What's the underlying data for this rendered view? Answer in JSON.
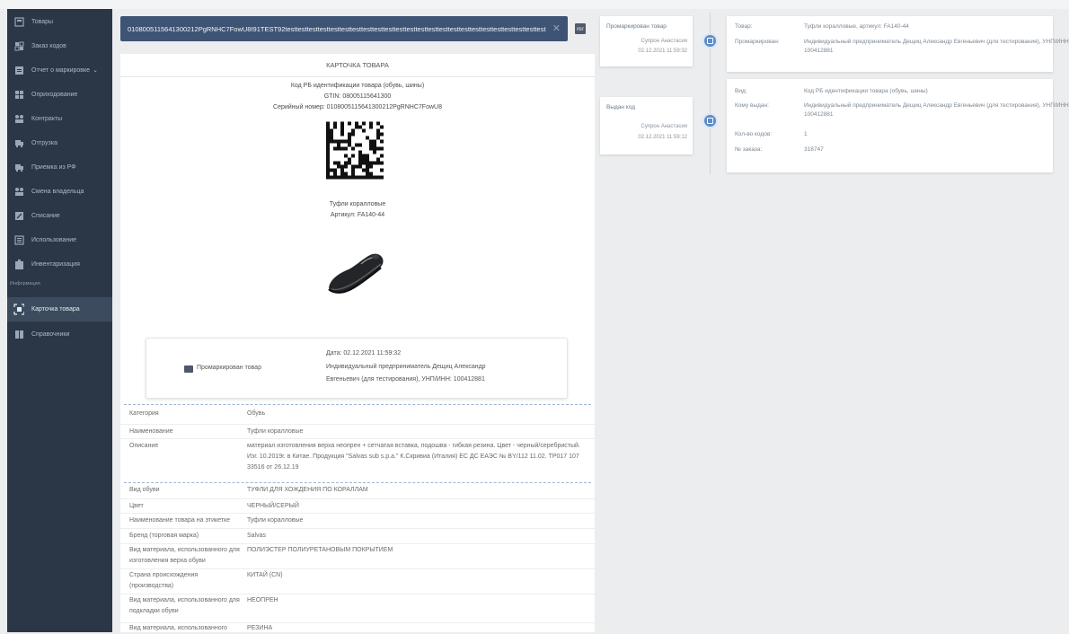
{
  "sidebar": {
    "items": [
      {
        "label": "Товары",
        "icon": "product-icon"
      },
      {
        "label": "Заказ кодов",
        "icon": "order-codes-icon"
      },
      {
        "label": "Отчет о маркировке",
        "icon": "report-icon",
        "chevron": "⌄"
      },
      {
        "label": "Оприходование",
        "icon": "receipt-icon"
      },
      {
        "label": "Контракты",
        "icon": "contracts-icon"
      },
      {
        "label": "Отгрузка",
        "icon": "shipment-icon"
      },
      {
        "label": "Приемка из РФ",
        "icon": "acceptance-icon"
      },
      {
        "label": "Смена владельца",
        "icon": "owner-change-icon"
      },
      {
        "label": "Списание",
        "icon": "write-off-icon"
      },
      {
        "label": "Использование",
        "icon": "usage-icon"
      },
      {
        "label": "Инвентаризация",
        "icon": "inventory-icon"
      }
    ],
    "section_label": "Информация",
    "info_items": [
      {
        "label": "Карточка товара",
        "icon": "product-card-icon",
        "active": true
      },
      {
        "label": "Справочники",
        "icon": "reference-books-icon"
      }
    ]
  },
  "code_bar": {
    "value": "0108005115641300212PgRNHC7FowU8I91TEST92testtesttesttesttesttesttesttesttesttesttesttesttesttesttesttesttesttesttesttesttesttesttesttest",
    "close": "✕",
    "pdf_label": "PDF"
  },
  "card": {
    "title": "КАРТОЧКА ТОВАРА",
    "code_type": "Код РБ идентификации товара (обувь, шины)",
    "gtin": "GTIN: 08005115641300",
    "serial": "Серийный номер: 0108005115641300212PgRNHC7FowU8",
    "product_name": "Туфли коралловые",
    "article": "Артикул: FA140-44",
    "status": {
      "label": "Промаркирован товар",
      "date": "Дата: 02.12.2021 11:59:32",
      "owner_line1": "Индивидуальный предприниматель Дещиц Александр",
      "owner_line2": "Евгеньевич (для тестирования), УНП/ИНН: 100412881"
    },
    "attributes": [
      {
        "key": "Категория",
        "value": "Обувь"
      },
      {
        "key": "Наименование",
        "value": "Туфли коралловые"
      },
      {
        "key": "Описание",
        "value": "материал изготовления верха неопрен + сетчатая вставка, подошва - гибкая резина. Цвет - черный/серебристый. Изг. 10.2019г. в Китае. Продукция \"Salvas sub s.p.a.\" К.Скривиа (Италия) ЕС ДС ЕАЭС № BY/112 11.02. ТР017 107 33516 от 26.12.19"
      },
      {
        "key": "Вид обуви",
        "value": "ТУФЛИ ДЛЯ ХОЖДЕНИЯ ПО КОРАЛЛАМ"
      },
      {
        "key": "Цвет",
        "value": "ЧЕРНЫЙ/СЕРЫЙ"
      },
      {
        "key": "Наименование товара на этикетке",
        "value": "Туфли коралловые"
      },
      {
        "key": "Бренд (торговая марка)",
        "value": "Salvas"
      },
      {
        "key": "Вид материала, использованного для изготовления верха обуви",
        "value": "ПОЛИЭСТЕР ПОЛИУРЕТАНОВЫМ ПОКРЫТИЕМ"
      },
      {
        "key": "Страна происхождения (производства)",
        "value": "КИТАЙ (CN)"
      },
      {
        "key": "Вид материала, использованного для подкладки обуви",
        "value": "НЕОПРЕН"
      },
      {
        "key": "Вид материала, использованного",
        "value": "РЕЗИНА"
      }
    ]
  },
  "timeline": {
    "events": [
      {
        "title": "Промаркирован товар",
        "user": "Супрон Анастасия",
        "date": "02.12.2021 11:59:32"
      },
      {
        "title": "Выдан код",
        "user": "Супрон Анастасия",
        "date": "02.12.2021 11:59:12"
      }
    ],
    "details": [
      {
        "rows": [
          {
            "key": "Товар:",
            "value": "Туфли коралловые, артикул: FA140-44"
          },
          {
            "key": "Промаркирован:",
            "value": "Индивидуальный предприниматель Дещиц Александр Евгеньевич (для тестирования), УНП/ИНН: 100412881"
          }
        ]
      },
      {
        "rows": [
          {
            "key": "Вид:",
            "value": "Код РБ идентификации товара (обувь, шины)"
          },
          {
            "key": "Кому выдан:",
            "value": "Индивидуальный предприниматель Дещиц Александр Евгеньевич (для тестирования), УНП/ИНН: 100412881"
          },
          {
            "key": "Кол-во кодов:",
            "value": "1"
          },
          {
            "key": "№ заказа:",
            "value": "318747"
          }
        ]
      }
    ]
  }
}
